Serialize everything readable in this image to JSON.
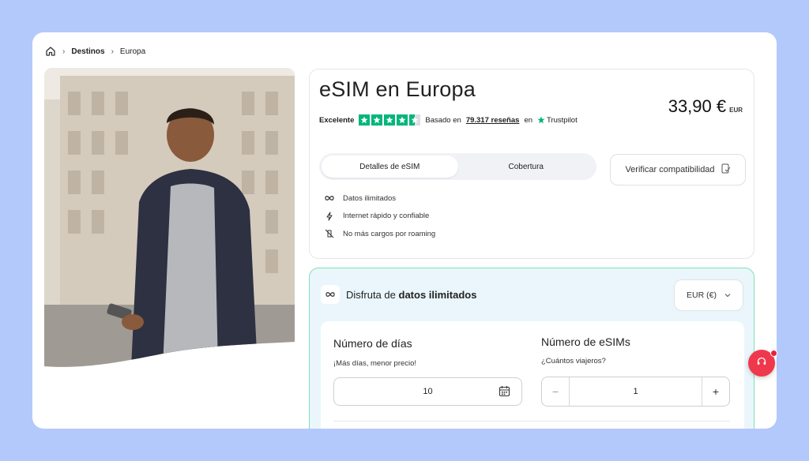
{
  "breadcrumb": {
    "home_icon": "home-icon",
    "items": [
      "Destinos",
      "Europa"
    ]
  },
  "product": {
    "title": "eSIM en Europa",
    "price": "33,90 €",
    "currency": "EUR",
    "rating": {
      "label": "Excelente",
      "stars": 4.5,
      "based_on": "Basado en",
      "reviews": "79.317 reseñas",
      "on": "en",
      "provider": "Trustpilot"
    },
    "tabs": [
      {
        "label": "Detalles de eSIM",
        "active": true
      },
      {
        "label": "Cobertura",
        "active": false
      }
    ],
    "verify_button": "Verificar compatibilidad",
    "features": [
      {
        "icon": "infinity-icon",
        "text": "Datos ilimitados"
      },
      {
        "icon": "lightning-icon",
        "text": "Internet rápido y confiable"
      },
      {
        "icon": "no-roaming-icon",
        "text": "No más cargos por roaming"
      }
    ]
  },
  "plan": {
    "title_prefix": "Disfruta de",
    "title_bold": "datos ilimitados",
    "currency_select": "EUR (€)",
    "days": {
      "title": "Número de días",
      "subtitle": "¡Más días, menor precio!",
      "value": "10"
    },
    "esims": {
      "title": "Número de eSIMs",
      "subtitle": "¿Cuántos viajeros?",
      "value": "1",
      "minus": "−",
      "plus": "+"
    }
  },
  "colors": {
    "background": "#b3c8fb",
    "trustpilot_green": "#00b67a",
    "plan_bg": "#eaf6fc",
    "plan_border": "#7ee0b3",
    "support_red": "#f0384d"
  }
}
